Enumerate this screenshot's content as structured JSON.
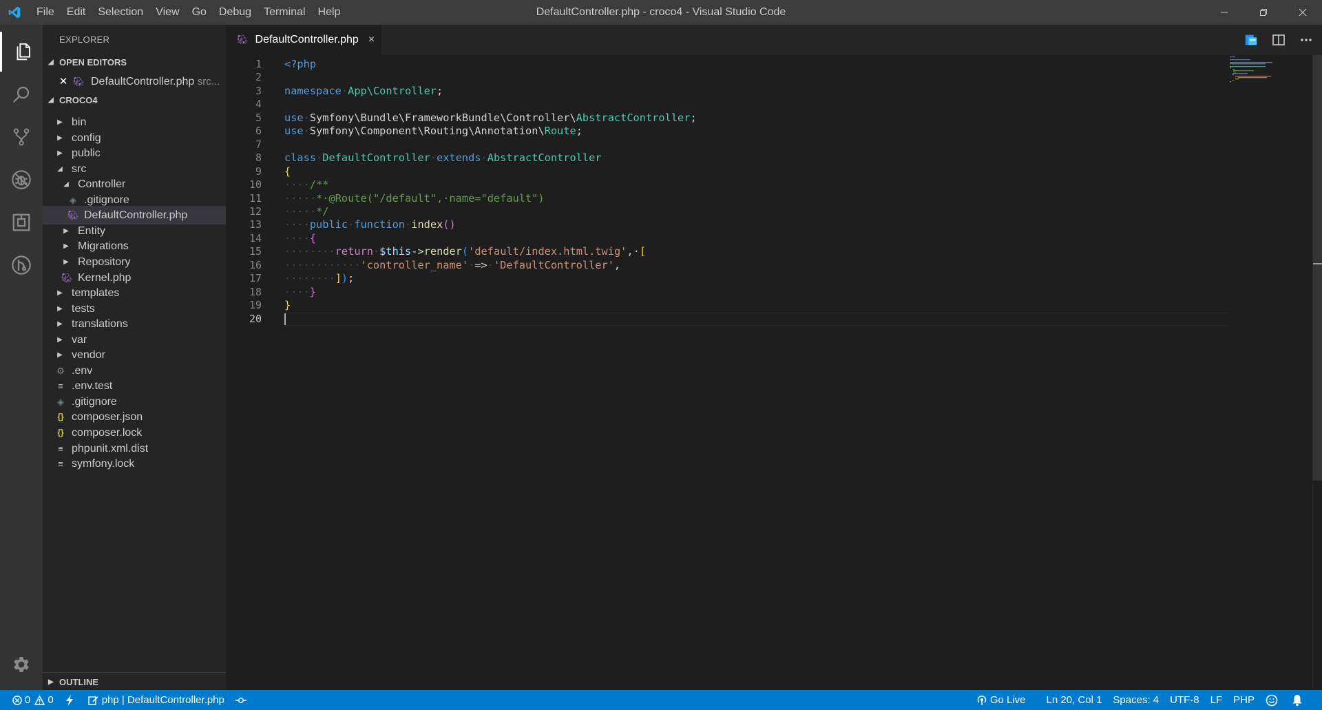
{
  "window": {
    "title": "DefaultController.php - croco4 - Visual Studio Code",
    "menu": [
      "File",
      "Edit",
      "Selection",
      "View",
      "Go",
      "Debug",
      "Terminal",
      "Help"
    ]
  },
  "sidebar": {
    "title": "EXPLORER",
    "open_editors": {
      "header": "OPEN EDITORS",
      "items": [
        {
          "name": "DefaultController.php",
          "desc": "src..."
        }
      ]
    },
    "project": {
      "header": "CROCO4",
      "tree": [
        {
          "label": "bin",
          "type": "folder",
          "expanded": false
        },
        {
          "label": "config",
          "type": "folder",
          "expanded": false
        },
        {
          "label": "public",
          "type": "folder",
          "expanded": false
        },
        {
          "label": "src",
          "type": "folder",
          "expanded": true
        },
        {
          "label": "Controller",
          "type": "folder",
          "expanded": true
        },
        {
          "label": ".gitignore",
          "type": "git"
        },
        {
          "label": "DefaultController.php",
          "type": "php",
          "selected": true
        },
        {
          "label": "Entity",
          "type": "folder",
          "expanded": false
        },
        {
          "label": "Migrations",
          "type": "folder",
          "expanded": false
        },
        {
          "label": "Repository",
          "type": "folder",
          "expanded": false
        },
        {
          "label": "Kernel.php",
          "type": "php"
        },
        {
          "label": "templates",
          "type": "folder",
          "expanded": false
        },
        {
          "label": "tests",
          "type": "folder",
          "expanded": false
        },
        {
          "label": "translations",
          "type": "folder",
          "expanded": false
        },
        {
          "label": "var",
          "type": "folder",
          "expanded": false
        },
        {
          "label": "vendor",
          "type": "folder",
          "expanded": false
        },
        {
          "label": ".env",
          "type": "gear"
        },
        {
          "label": ".env.test",
          "type": "text"
        },
        {
          "label": ".gitignore",
          "type": "git"
        },
        {
          "label": "composer.json",
          "type": "json"
        },
        {
          "label": "composer.lock",
          "type": "json"
        },
        {
          "label": "phpunit.xml.dist",
          "type": "text"
        },
        {
          "label": "symfony.lock",
          "type": "text"
        }
      ]
    },
    "outline": {
      "header": "OUTLINE"
    }
  },
  "editor": {
    "tab": {
      "label": "DefaultController.php",
      "close": "×"
    },
    "current_line": 20,
    "lines": [
      [
        {
          "t": "<?php",
          "c": "c-kw"
        }
      ],
      [],
      [
        {
          "t": "namespace",
          "c": "c-kw"
        },
        {
          "t": "·",
          "c": "ws"
        },
        {
          "t": "App\\Controller",
          "c": "c-ns"
        },
        {
          "t": ";",
          "c": ""
        }
      ],
      [],
      [
        {
          "t": "use",
          "c": "c-kw"
        },
        {
          "t": "·",
          "c": "ws"
        },
        {
          "t": "Symfony\\Bundle\\FrameworkBundle\\Controller\\",
          "c": ""
        },
        {
          "t": "AbstractController",
          "c": "c-ns"
        },
        {
          "t": ";",
          "c": ""
        }
      ],
      [
        {
          "t": "use",
          "c": "c-kw"
        },
        {
          "t": "·",
          "c": "ws"
        },
        {
          "t": "Symfony\\Component\\Routing\\Annotation\\",
          "c": ""
        },
        {
          "t": "Route",
          "c": "c-ns"
        },
        {
          "t": ";",
          "c": ""
        }
      ],
      [],
      [
        {
          "t": "class",
          "c": "c-kw"
        },
        {
          "t": "·",
          "c": "ws"
        },
        {
          "t": "DefaultController",
          "c": "c-ns"
        },
        {
          "t": "·",
          "c": "ws"
        },
        {
          "t": "extends",
          "c": "c-kw"
        },
        {
          "t": "·",
          "c": "ws"
        },
        {
          "t": "AbstractController",
          "c": "c-ns"
        }
      ],
      [
        {
          "t": "{",
          "c": "c-br1"
        }
      ],
      [
        {
          "t": "····",
          "c": "ws"
        },
        {
          "t": "/**",
          "c": "c-com"
        }
      ],
      [
        {
          "t": "·····",
          "c": "ws"
        },
        {
          "t": "*·@Route(\"/default\",·name=\"default\")",
          "c": "c-com"
        }
      ],
      [
        {
          "t": "·····",
          "c": "ws"
        },
        {
          "t": "*/",
          "c": "c-com"
        }
      ],
      [
        {
          "t": "····",
          "c": "ws"
        },
        {
          "t": "public",
          "c": "c-kw"
        },
        {
          "t": "·",
          "c": "ws"
        },
        {
          "t": "function",
          "c": "c-kw"
        },
        {
          "t": "·",
          "c": "ws"
        },
        {
          "t": "index",
          "c": "c-fn"
        },
        {
          "t": "()",
          "c": "c-br2"
        }
      ],
      [
        {
          "t": "····",
          "c": "ws"
        },
        {
          "t": "{",
          "c": "c-br2"
        }
      ],
      [
        {
          "t": "········",
          "c": "ws"
        },
        {
          "t": "return",
          "c": "c-ret"
        },
        {
          "t": "·",
          "c": "ws"
        },
        {
          "t": "$this",
          "c": "c-var"
        },
        {
          "t": "->",
          "c": ""
        },
        {
          "t": "render",
          "c": "c-fn"
        },
        {
          "t": "(",
          "c": "c-br3"
        },
        {
          "t": "'default/index.html.twig'",
          "c": "c-str"
        },
        {
          "t": ",·",
          "c": ""
        },
        {
          "t": "[",
          "c": "c-br1"
        }
      ],
      [
        {
          "t": "············",
          "c": "ws"
        },
        {
          "t": "'controller_name'",
          "c": "c-str"
        },
        {
          "t": "·",
          "c": "ws"
        },
        {
          "t": "=>",
          "c": ""
        },
        {
          "t": "·",
          "c": "ws"
        },
        {
          "t": "'DefaultController'",
          "c": "c-str"
        },
        {
          "t": ",",
          "c": ""
        }
      ],
      [
        {
          "t": "········",
          "c": "ws"
        },
        {
          "t": "]",
          "c": "c-br1"
        },
        {
          "t": ")",
          "c": "c-br3"
        },
        {
          "t": ";",
          "c": ""
        }
      ],
      [
        {
          "t": "····",
          "c": "ws"
        },
        {
          "t": "}",
          "c": "c-br2"
        }
      ],
      [
        {
          "t": "}",
          "c": "c-br1"
        }
      ],
      []
    ]
  },
  "statusbar": {
    "errors": "0",
    "warnings": "0",
    "language_file": "php | DefaultController.php",
    "go_live": "Go Live",
    "position": "Ln 20, Col 1",
    "spaces": "Spaces: 4",
    "encoding": "UTF-8",
    "eol": "LF",
    "language": "PHP"
  },
  "colors": {
    "accent": "#007acc",
    "php_icon": "#a074c4",
    "json_icon": "#cbcb41"
  }
}
